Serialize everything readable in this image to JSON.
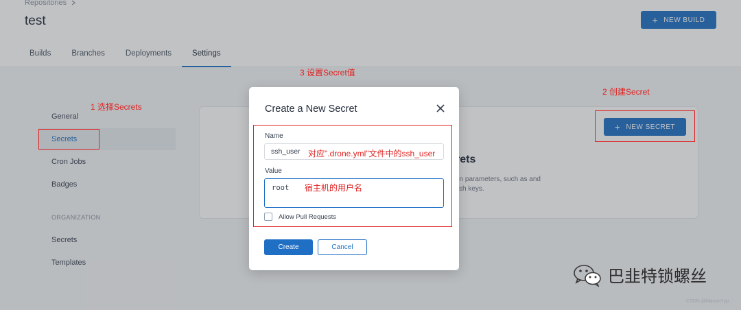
{
  "header": {
    "breadcrumb": "Repositories",
    "title": "test",
    "new_build_label": "NEW BUILD",
    "tabs": [
      {
        "label": "Builds"
      },
      {
        "label": "Branches"
      },
      {
        "label": "Deployments"
      },
      {
        "label": "Settings",
        "active": true
      }
    ]
  },
  "sidebar": {
    "items": [
      {
        "label": "General"
      },
      {
        "label": "Secrets",
        "selected": true
      },
      {
        "label": "Cron Jobs"
      },
      {
        "label": "Badges"
      }
    ],
    "org_heading": "ORGANIZATION",
    "org_items": [
      {
        "label": "Secrets"
      },
      {
        "label": "Templates"
      }
    ]
  },
  "content": {
    "new_secret_label": "NEW SECRET",
    "heading_fragment": "rets",
    "desc_fragment": "on parameters, such as and ssh keys."
  },
  "modal": {
    "title": "Create a New Secret",
    "name_label": "Name",
    "name_value": "ssh_user",
    "value_label": "Value",
    "value_text": "root",
    "allow_pull_label": "Allow Pull Requests",
    "allow_pull_checked": false,
    "create_label": "Create",
    "cancel_label": "Cancel"
  },
  "annotations": {
    "step1": "1 选择Secrets",
    "step2": "2 创建Secret",
    "step3": "3 设置Secret值",
    "name_note": "对应\".drone.yml\"文件中的ssh_user",
    "value_note": "宿主机的用户名"
  },
  "watermark": {
    "text": "巴韭特锁螺丝",
    "csdn": "CSDN @MasonYyp"
  },
  "colors": {
    "accent": "#1f6fc5",
    "annotation": "#e02020"
  }
}
